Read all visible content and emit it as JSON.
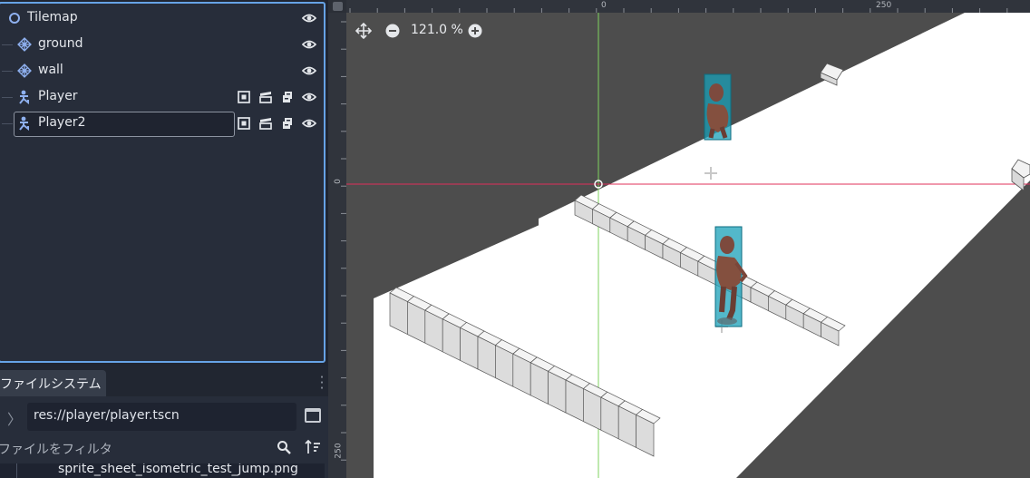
{
  "scene_tree": {
    "nodes": [
      {
        "label": "Tilemap",
        "icon": "node2d-circle-icon"
      },
      {
        "label": "ground",
        "icon": "tilemap-layer-icon"
      },
      {
        "label": "wall",
        "icon": "tilemap-layer-icon"
      },
      {
        "label": "Player",
        "icon": "character-body-icon"
      },
      {
        "label": "Player2",
        "icon": "character-body-icon",
        "editing": true
      }
    ]
  },
  "filesystem": {
    "tab_label": "ファイルシステム",
    "path": "res://player/player.tscn",
    "filter_placeholder": "ファイルをフィルタ",
    "file_item": "sprite_sheet_isometric_test_jump.png"
  },
  "viewport": {
    "zoom_label": "121.0 %",
    "ruler_top": [
      "0",
      "250"
    ],
    "ruler_left": [
      "0",
      "250"
    ]
  },
  "colors": {
    "accent": "#66a3e6",
    "icon_blue": "#8fb1f0",
    "x_axis": "#e0305a",
    "y_axis": "#7fd35f"
  }
}
